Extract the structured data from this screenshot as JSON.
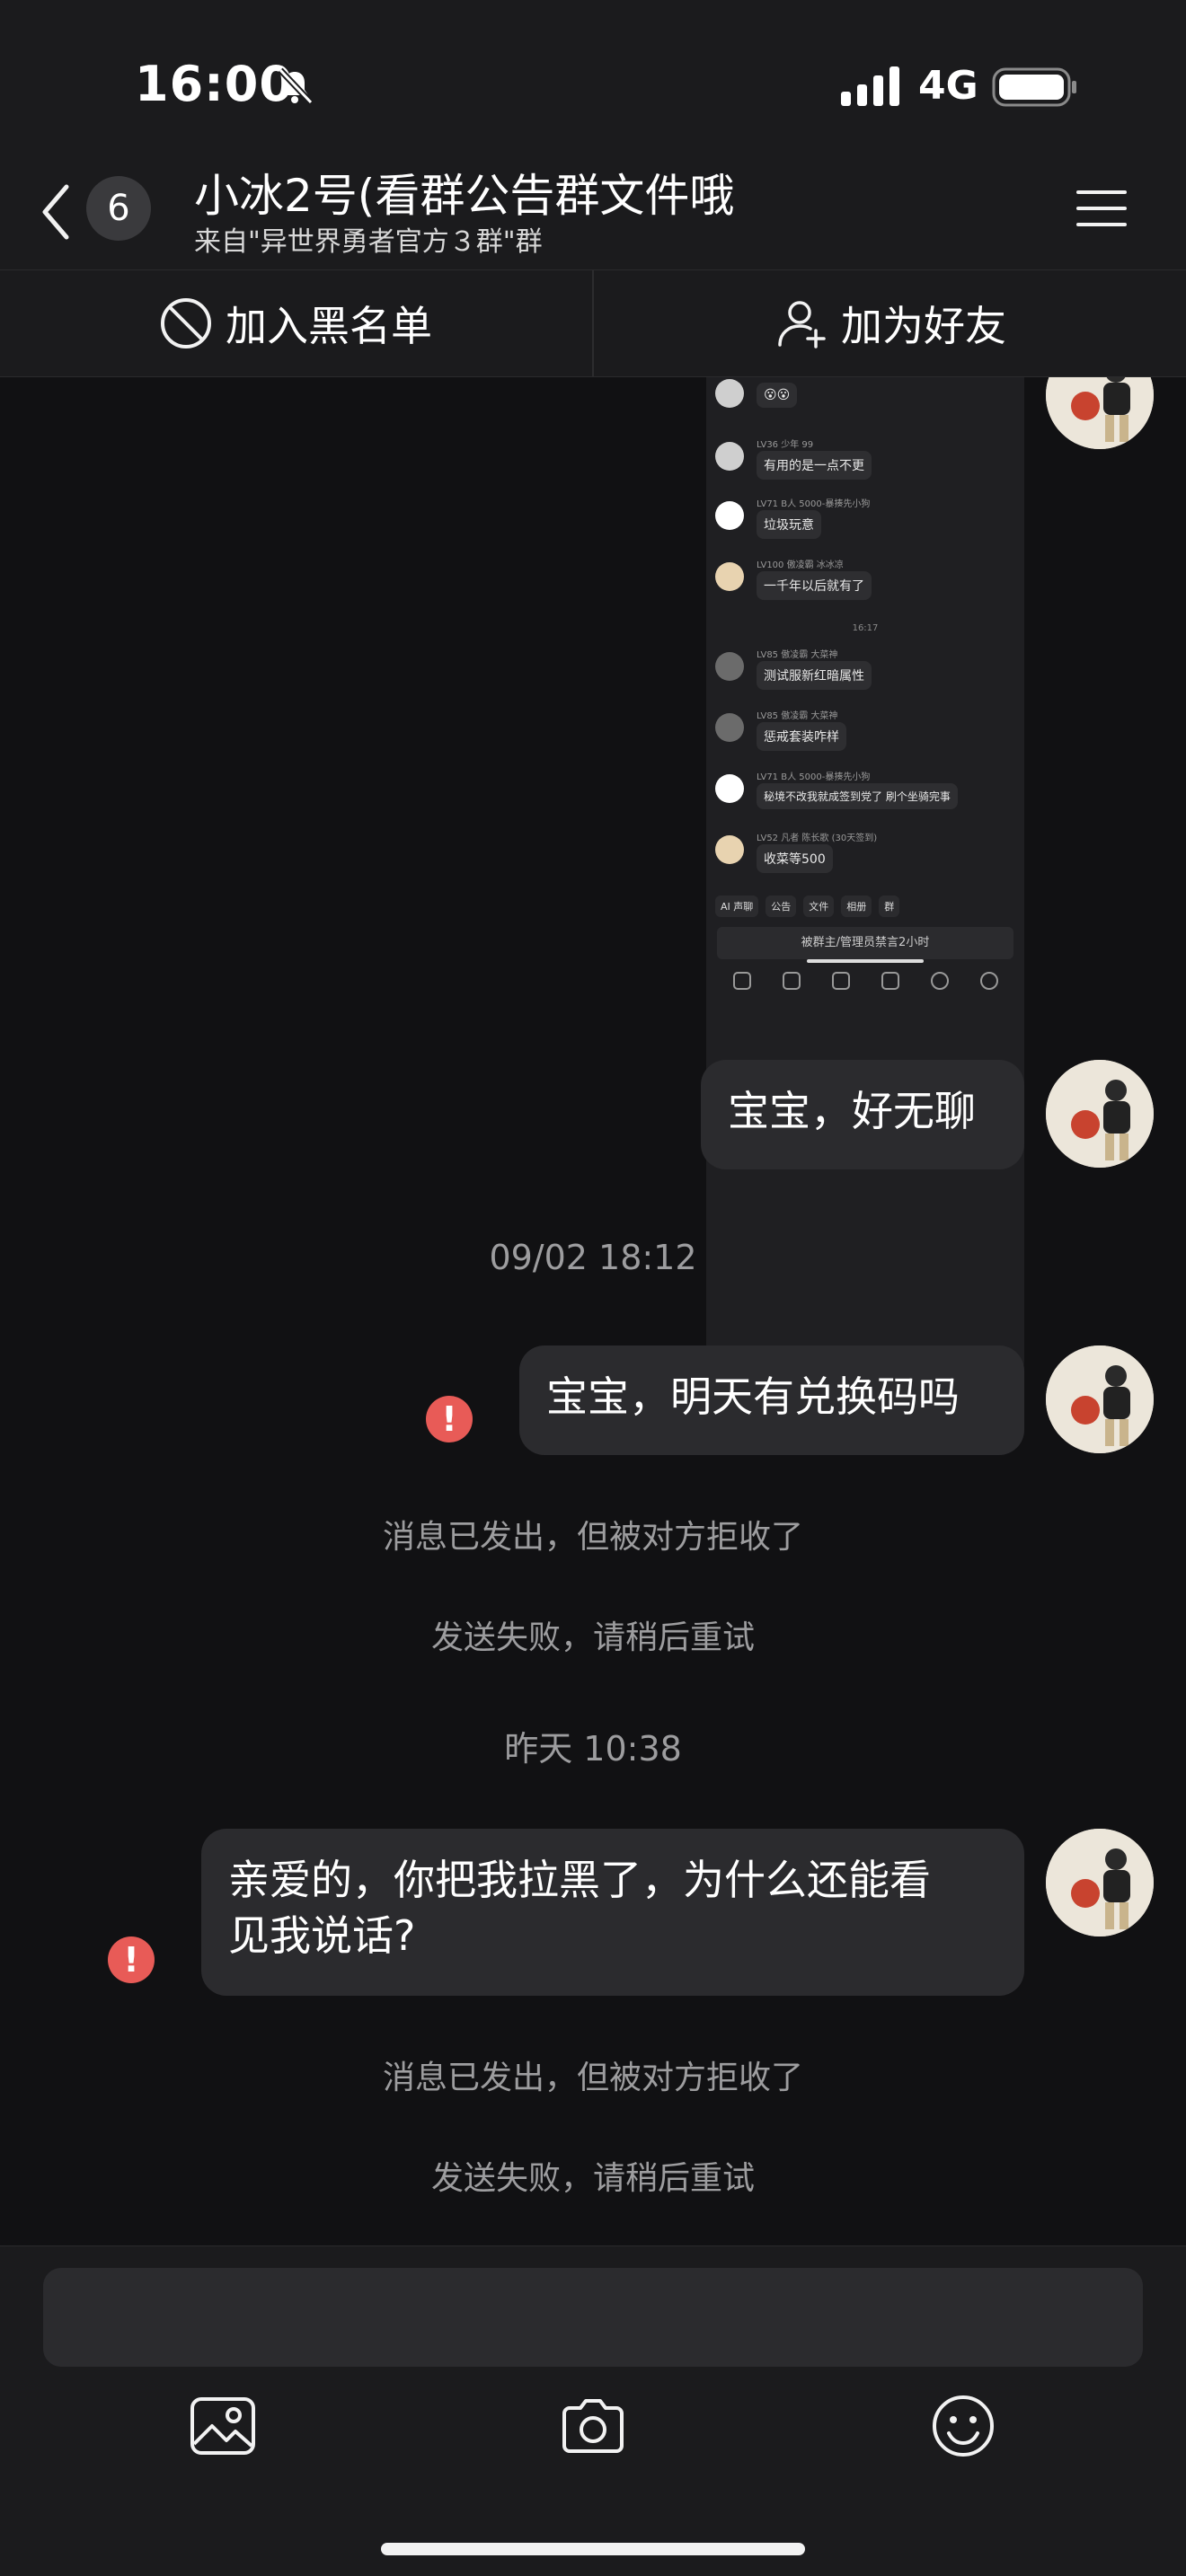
{
  "status_bar": {
    "time": "16:00",
    "network": "4G"
  },
  "header": {
    "unread_count": "6",
    "title": "小冰2号(看群公告群文件哦",
    "subtitle": "来自\"异世界勇者官方３群\"群"
  },
  "actions": {
    "block_label": "加入黑名单",
    "add_friend_label": "加为好友"
  },
  "embedded_screenshot": {
    "rows": [
      {
        "meta": "",
        "text": "😮😮"
      },
      {
        "meta": "LV36 少年  99",
        "text": "有用的是一点不更"
      },
      {
        "meta": "LV71 B人  5000-暴揍先小狗",
        "text": "垃圾玩意"
      },
      {
        "meta": "LV100 傲凌霸  冰冰凉",
        "text": "一千年以后就有了"
      },
      {
        "meta": "LV85 傲凌霸  大菜神",
        "text": "测试服新红暗属性"
      },
      {
        "meta": "LV85 傲凌霸  大菜神",
        "text": "惩戒套装咋样"
      },
      {
        "meta": "LV71 B人  5000-暴揍先小狗",
        "text": "秘境不改我就成签到党了 刷个坐骑完事"
      },
      {
        "meta": "LV52 凡者  陈长歌 (30天签到)",
        "text": "收菜等500"
      }
    ],
    "timestamp": "16:17",
    "toolbar": [
      "AI 声聊",
      "公告",
      "文件",
      "相册",
      "群"
    ],
    "muted_notice": "被群主/管理员禁言2小时"
  },
  "messages": [
    {
      "text": "宝宝，好无聊"
    },
    {
      "timestamp": "09/02 18:12"
    },
    {
      "text": "宝宝，明天有兑换码吗",
      "failed": true
    },
    {
      "notice": "消息已发出，但被对方拒收了"
    },
    {
      "notice": "发送失败，请稍后重试"
    },
    {
      "timestamp": "昨天 10:38"
    },
    {
      "text_line1": "亲爱的，你把我拉黑了，为什么还能看",
      "text_line2": "见我说话?",
      "failed": true
    },
    {
      "notice": "消息已发出，但被对方拒收了"
    },
    {
      "notice": "发送失败，请稍后重试"
    }
  ],
  "composer": {
    "input_value": "",
    "error_glyph": "!"
  },
  "colors": {
    "background": "#111113",
    "bar": "#1b1b1d",
    "bubble": "#2b2b2e",
    "error": "#e85b57",
    "system_text": "#9d9d9f"
  },
  "icons": [
    "bell-slash-icon",
    "signal-icon",
    "battery-icon",
    "chevron-left-icon",
    "menu-icon",
    "block-icon",
    "add-user-icon",
    "image-icon",
    "camera-icon",
    "emoji-icon"
  ]
}
